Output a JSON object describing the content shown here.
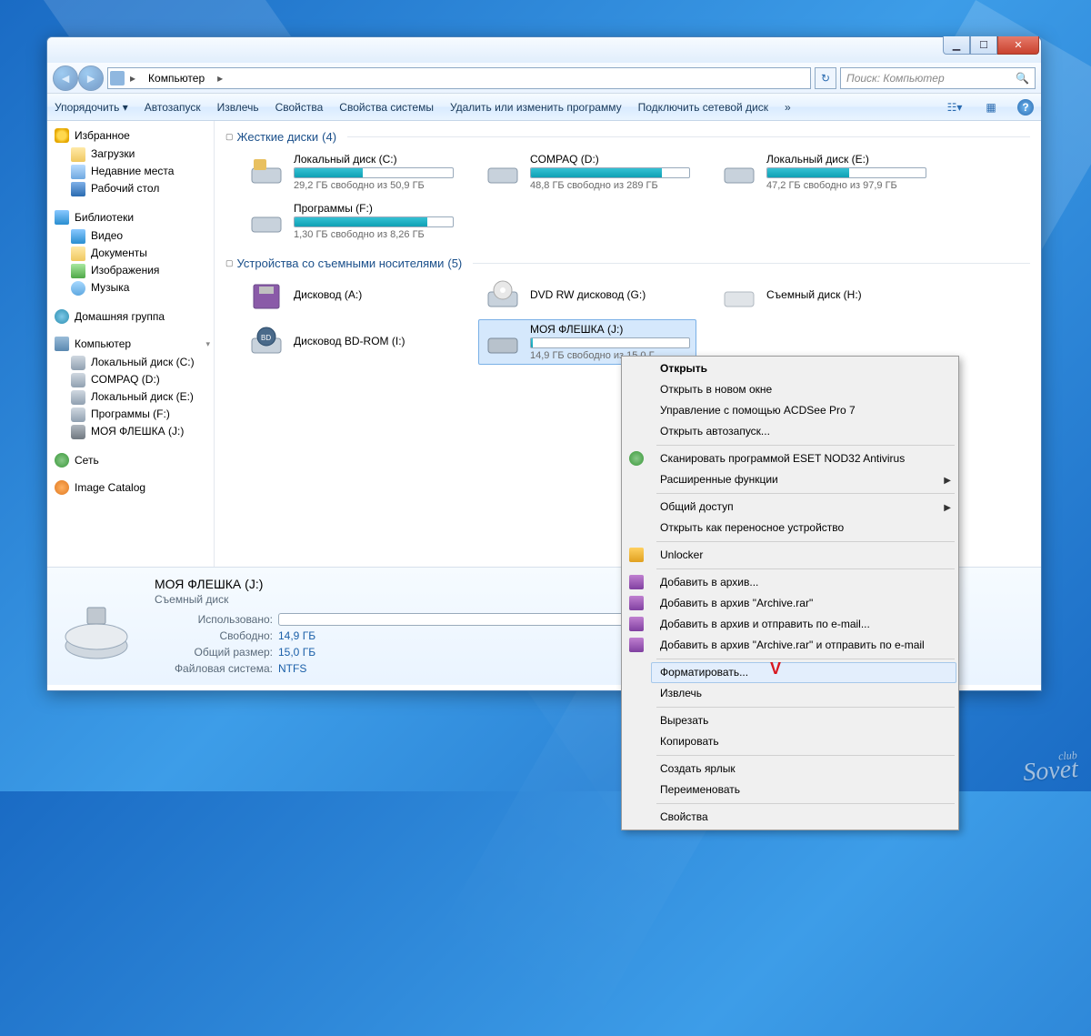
{
  "address": {
    "location": "Компьютер"
  },
  "search": {
    "placeholder": "Поиск: Компьютер"
  },
  "window_controls": {
    "min": "▁",
    "max": "☐",
    "close": "✕"
  },
  "toolbar": {
    "organize": "Упорядочить ▾",
    "autoplay": "Автозапуск",
    "eject": "Извлечь",
    "properties": "Свойства",
    "system_properties": "Свойства системы",
    "uninstall": "Удалить или изменить программу",
    "map_drive": "Подключить сетевой диск",
    "overflow": "»"
  },
  "sidebar": {
    "favorites": {
      "label": "Избранное",
      "items": [
        "Загрузки",
        "Недавние места",
        "Рабочий стол"
      ]
    },
    "libraries": {
      "label": "Библиотеки",
      "items": [
        "Видео",
        "Документы",
        "Изображения",
        "Музыка"
      ]
    },
    "homegroup": {
      "label": "Домашняя группа"
    },
    "computer": {
      "label": "Компьютер",
      "items": [
        "Локальный диск (C:)",
        "COMPAQ (D:)",
        "Локальный диск (E:)",
        "Программы (F:)",
        "МОЯ ФЛЕШКА (J:)"
      ]
    },
    "network": {
      "label": "Сеть"
    },
    "image_catalog": {
      "label": "Image Catalog"
    }
  },
  "groups": {
    "hdd": {
      "label": "Жесткие диски",
      "count_text": "(4)"
    },
    "removable": {
      "label": "Устройства со съемными носителями",
      "count_text": "(5)"
    }
  },
  "drives": {
    "c": {
      "name": "Локальный диск (C:)",
      "stat": "29,2 ГБ свободно из 50,9 ГБ",
      "fill": 43
    },
    "d": {
      "name": "COMPAQ (D:)",
      "stat": "48,8 ГБ свободно из 289 ГБ",
      "fill": 83
    },
    "e": {
      "name": "Локальный диск (E:)",
      "stat": "47,2 ГБ свободно из 97,9 ГБ",
      "fill": 52
    },
    "f": {
      "name": "Программы (F:)",
      "stat": "1,30 ГБ свободно из 8,26 ГБ",
      "fill": 84
    },
    "a": {
      "name": "Дисковод (A:)"
    },
    "g": {
      "name": "DVD RW дисковод (G:)"
    },
    "h": {
      "name": "Съемный диск (H:)"
    },
    "i": {
      "name": "Дисковод BD-ROM (I:)"
    },
    "j": {
      "name": "МОЯ ФЛЕШКА (J:)",
      "stat": "14,9 ГБ свободно из 15,0 Г",
      "fill": 1
    }
  },
  "details": {
    "title": "МОЯ ФЛЕШКА (J:)",
    "subtitle": "Съемный диск",
    "used_label": "Использовано:",
    "free_label": "Свободно:",
    "free_value": "14,9 ГБ",
    "total_label": "Общий размер:",
    "total_value": "15,0 ГБ",
    "fs_label": "Файловая система:",
    "fs_value": "NTFS",
    "used_fill": 1
  },
  "context_menu": {
    "open": "Открыть",
    "open_new": "Открыть в новом окне",
    "acdsee": "Управление с помощью ACDSee Pro 7",
    "autoplay": "Открыть автозапуск...",
    "eset": "Сканировать программой ESET NOD32 Antivirus",
    "adv": "Расширенные функции",
    "share": "Общий доступ",
    "portable": "Открыть как переносное устройство",
    "unlocker": "Unlocker",
    "rar1": "Добавить в архив...",
    "rar2": "Добавить в архив \"Archive.rar\"",
    "rar3": "Добавить в архив и отправить по e-mail...",
    "rar4": "Добавить в архив \"Archive.rar\" и отправить по e-mail",
    "format": "Форматировать...",
    "eject": "Извлечь",
    "cut": "Вырезать",
    "copy": "Копировать",
    "shortcut": "Создать ярлык",
    "rename": "Переименовать",
    "properties": "Свойства"
  },
  "watermark": {
    "small": "club",
    "big": "Sovet"
  }
}
